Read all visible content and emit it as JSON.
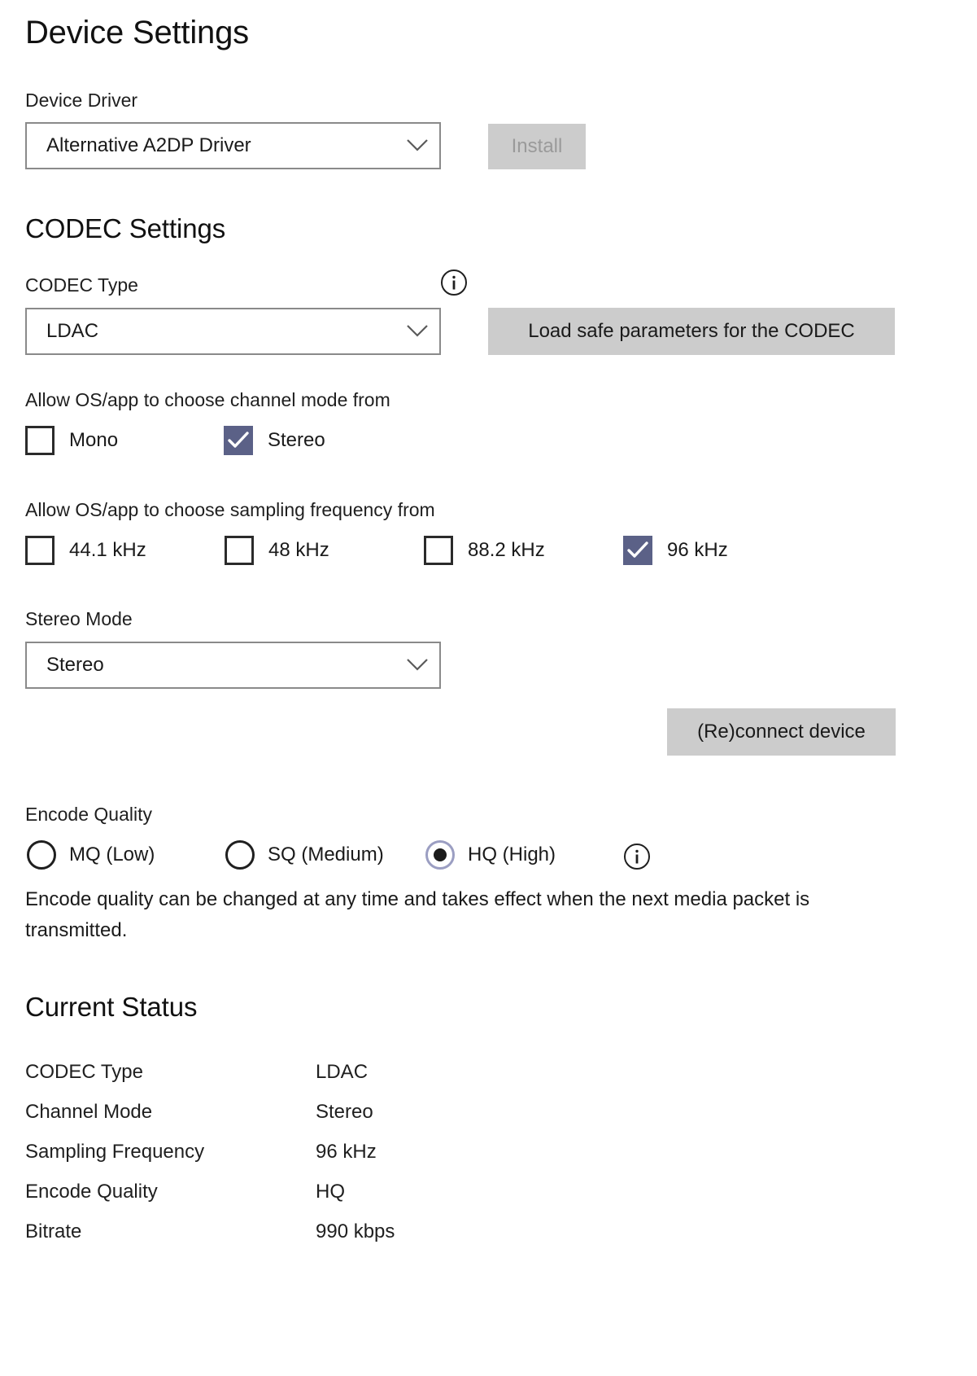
{
  "page": {
    "title": "Device Settings"
  },
  "device_driver": {
    "label": "Device Driver",
    "selected": "Alternative A2DP Driver",
    "install_button": "Install",
    "install_enabled": false
  },
  "codec_settings": {
    "heading": "CODEC Settings",
    "codec_type_label": "CODEC Type",
    "codec_type_selected": "LDAC",
    "load_safe_button": "Load safe parameters for the CODEC",
    "info_icon": "info-icon",
    "channel_mode": {
      "label": "Allow OS/app to choose channel mode from",
      "options": [
        {
          "label": "Mono",
          "checked": false
        },
        {
          "label": "Stereo",
          "checked": true
        }
      ]
    },
    "sampling_frequency": {
      "label": "Allow OS/app to choose sampling frequency from",
      "options": [
        {
          "label": "44.1 kHz",
          "checked": false
        },
        {
          "label": "48 kHz",
          "checked": false
        },
        {
          "label": "88.2 kHz",
          "checked": false
        },
        {
          "label": "96 kHz",
          "checked": true
        }
      ]
    },
    "stereo_mode_label": "Stereo Mode",
    "stereo_mode_selected": "Stereo",
    "reconnect_button": "(Re)connect device"
  },
  "encode_quality": {
    "label": "Encode Quality",
    "options": [
      {
        "label": "MQ (Low)",
        "selected": false
      },
      {
        "label": "SQ (Medium)",
        "selected": false
      },
      {
        "label": "HQ (High)",
        "selected": true
      }
    ],
    "info_icon": "info-icon",
    "description": "Encode quality can be changed at any time and takes effect when the next media packet is transmitted."
  },
  "current_status": {
    "heading": "Current Status",
    "rows": [
      {
        "key": "CODEC Type",
        "value": "LDAC"
      },
      {
        "key": "Channel Mode",
        "value": "Stereo"
      },
      {
        "key": "Sampling Frequency",
        "value": "96 kHz"
      },
      {
        "key": "Encode Quality",
        "value": "HQ"
      },
      {
        "key": "Bitrate",
        "value": "990 kbps"
      }
    ]
  },
  "colors": {
    "accent_checkbox": "#5b6187",
    "button_face": "#cccccc",
    "combo_border": "#8a8a8a",
    "text": "#1a1a1a",
    "disabled_text": "#9a9a9a"
  }
}
